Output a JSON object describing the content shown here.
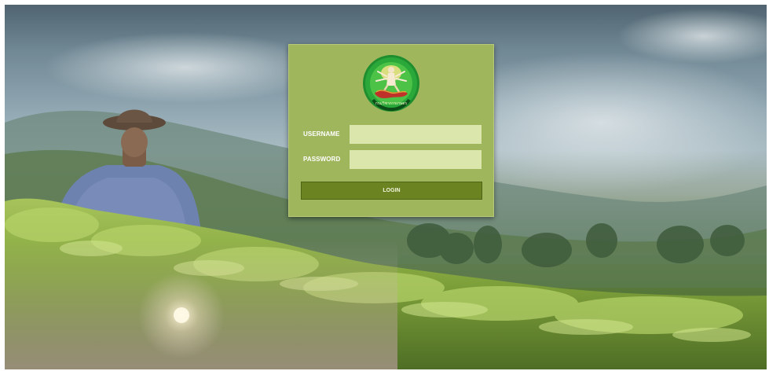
{
  "login": {
    "username_label": "USERNAME",
    "password_label": "PASSWORD",
    "username_value": "",
    "password_value": "",
    "login_button_label": "LOGIN"
  },
  "logo": {
    "icon": "deity-emblem-logo",
    "text": "กรมวิชาการเกษตร"
  },
  "colors": {
    "panel": "#9fb65d",
    "input": "#dbe6ad",
    "button": "#6c8322",
    "logo_green": "#2aa83a"
  }
}
